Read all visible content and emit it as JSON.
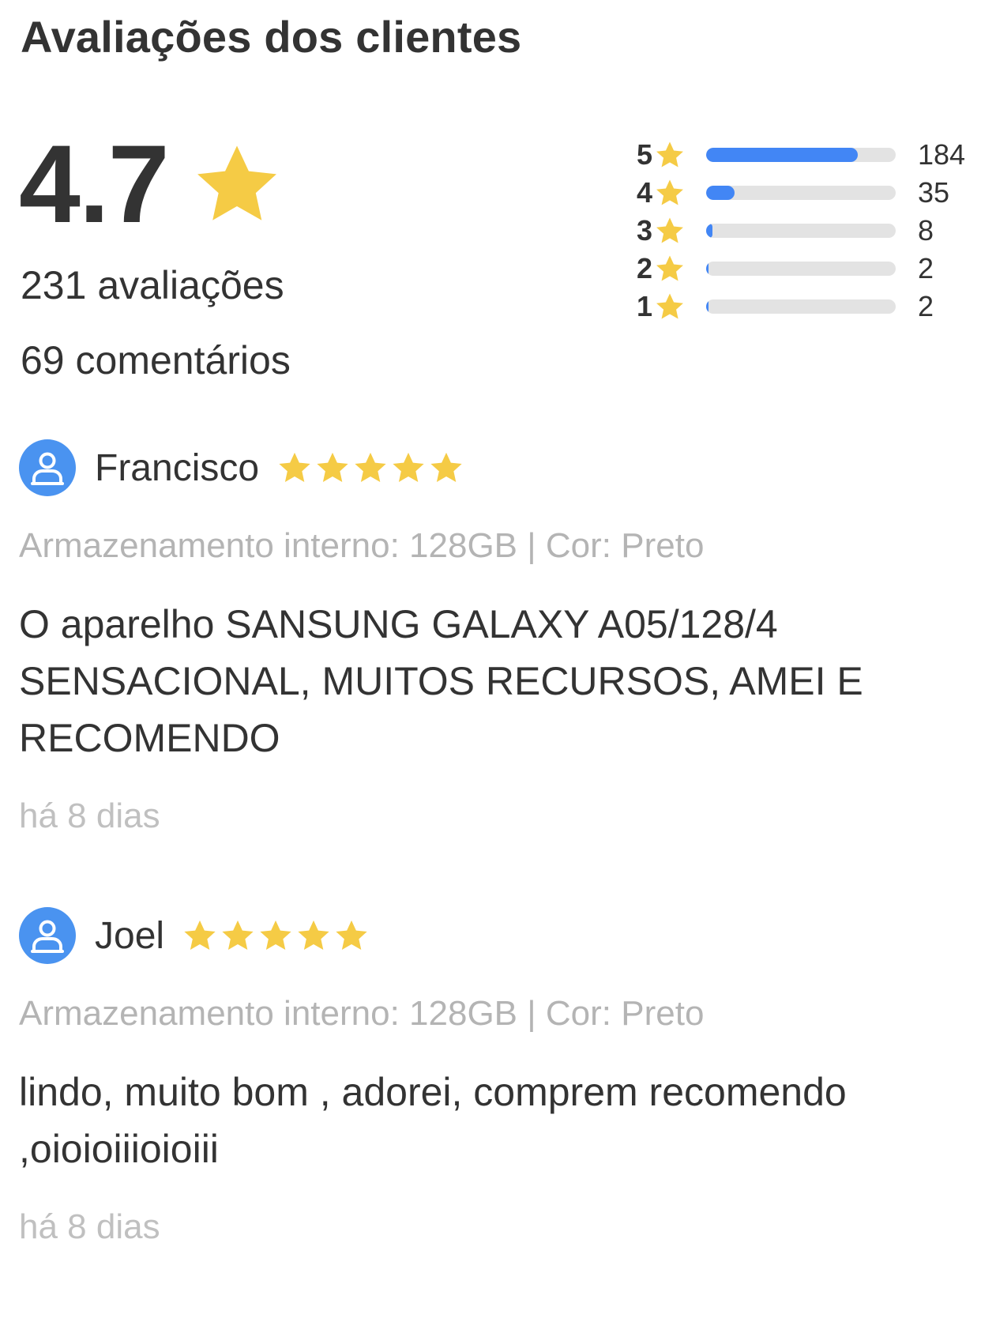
{
  "header": {
    "title": "Avaliações dos clientes"
  },
  "summary": {
    "average": "4.7",
    "total_ratings": "231 avaliações",
    "total_comments": "69 comentários",
    "star_color": "#f5cb45",
    "accent_color": "#4286f5"
  },
  "distribution": [
    {
      "level": "5",
      "count": "184",
      "fraction": 0.8
    },
    {
      "level": "4",
      "count": "35",
      "fraction": 0.15
    },
    {
      "level": "3",
      "count": "8",
      "fraction": 0.035
    },
    {
      "level": "2",
      "count": "2",
      "fraction": 0.01
    },
    {
      "level": "1",
      "count": "2",
      "fraction": 0.01
    }
  ],
  "reviews": [
    {
      "name": "Francisco",
      "stars": 5,
      "variant": "Armazenamento interno: 128GB | Cor: Preto",
      "text": "O aparelho SANSUNG GALAXY A05/128/4 SENSACIONAL, MUITOS RECURSOS, AMEI E RECOMENDO",
      "date": "há 8 dias"
    },
    {
      "name": "Joel",
      "stars": 5,
      "variant": "Armazenamento interno: 128GB | Cor: Preto",
      "text": "lindo, muito bom , adorei, comprem recomendo ,oioioiiioioiii",
      "date": "há 8 dias"
    }
  ]
}
